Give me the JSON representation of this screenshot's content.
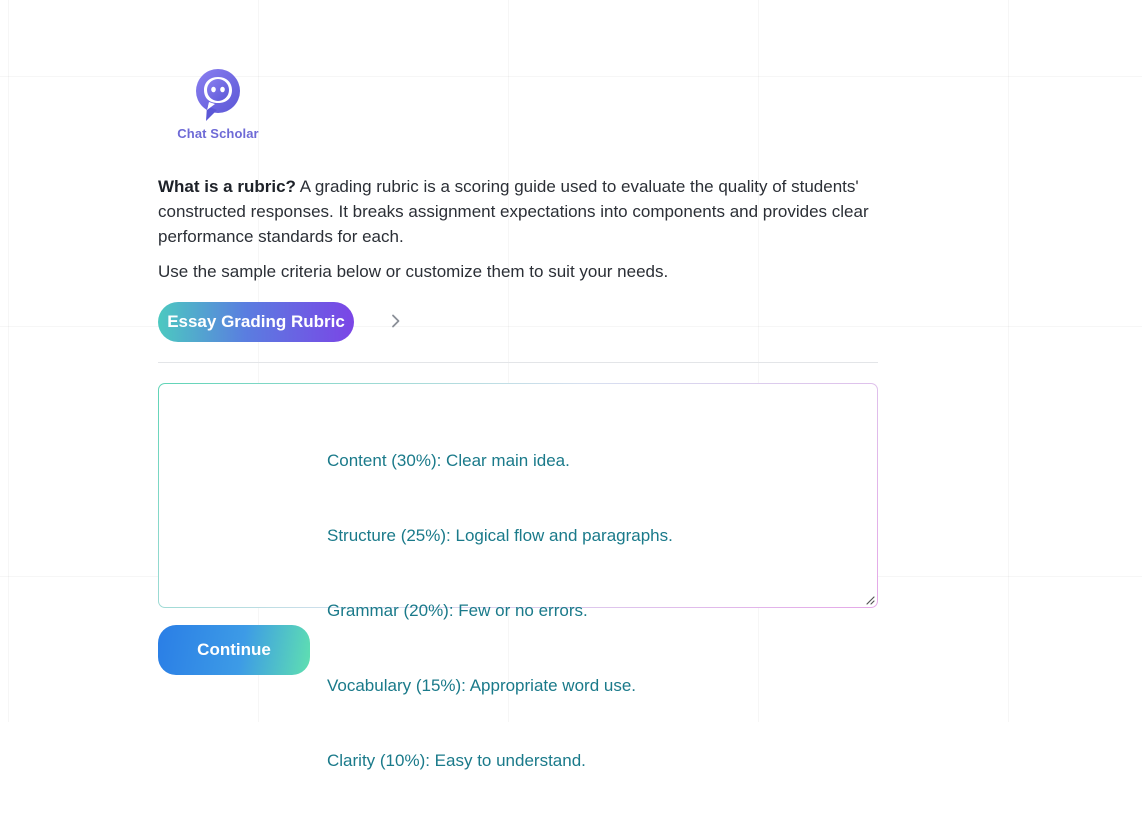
{
  "brand": {
    "name": "Chat Scholar",
    "logo_icon": "chat-bubble-icon",
    "accent_color": "#6e6ad6"
  },
  "intro": {
    "heading": "What is a rubric?",
    "body": " A grading rubric is a scoring guide used to evaluate the quality of students' constructed responses. It breaks assignment expectations into components and provides clear performance standards for each.",
    "instruction": "Use the sample criteria below or customize them to suit your needs."
  },
  "rubric_selector": {
    "label": "Essay Grading Rubric",
    "next_icon": "chevron-right-icon"
  },
  "criteria": {
    "lines": [
      "Content (30%): Clear main idea.",
      "Structure (25%): Logical flow and paragraphs.",
      "Grammar (20%): Few or no errors.",
      "Vocabulary (15%): Appropriate word use.",
      "Clarity (10%): Easy to understand."
    ],
    "text_color": "#1a7a8a"
  },
  "actions": {
    "continue_label": "Continue"
  }
}
